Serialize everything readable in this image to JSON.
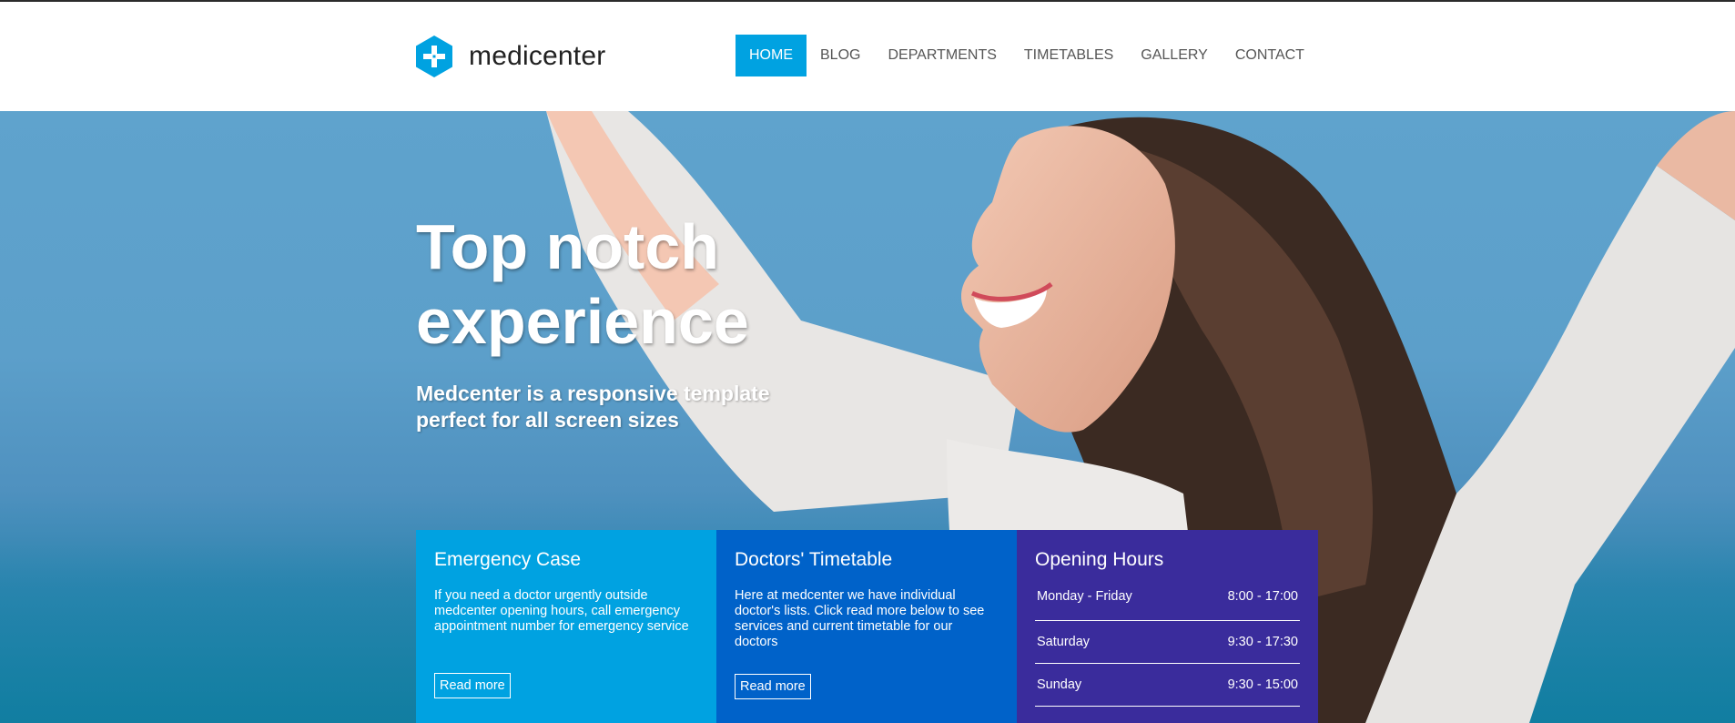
{
  "brand": {
    "name": "medicenter",
    "accent": "#00a2e1"
  },
  "nav": {
    "items": [
      {
        "label": "HOME",
        "active": true
      },
      {
        "label": "BLOG"
      },
      {
        "label": "DEPARTMENTS"
      },
      {
        "label": "TIMETABLES"
      },
      {
        "label": "GALLERY"
      },
      {
        "label": "CONTACT"
      }
    ]
  },
  "hero": {
    "title_line1": "Top notch",
    "title_line2": "experience",
    "subtitle_line1": "Medcenter is a responsive template",
    "subtitle_line2": "perfect for all screen sizes"
  },
  "boxes": {
    "emergency": {
      "title": "Emergency Case",
      "text": "If you need a doctor urgently outside medcenter opening hours, call emergency appointment number for emergency service",
      "button": "Read more",
      "color": "#00a2e1"
    },
    "timetable": {
      "title": "Doctors' Timetable",
      "text": "Here at medcenter we have individual doctor's lists. Click read more below to see services and current timetable for our doctors",
      "button": "Read more",
      "color": "#0062c9"
    },
    "hours": {
      "title": "Opening Hours",
      "color": "#3a2c9c",
      "rows": [
        {
          "day": "Monday - Friday",
          "time": "8:00 - 17:00"
        },
        {
          "day": "Saturday",
          "time": "9:30 - 17:30"
        },
        {
          "day": "Sunday",
          "time": "9:30 - 15:00"
        }
      ]
    }
  }
}
